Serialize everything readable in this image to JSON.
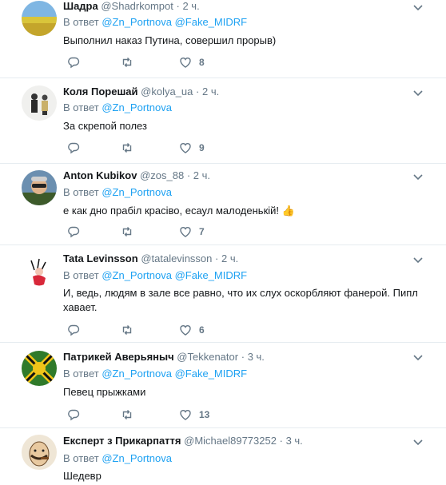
{
  "reply_prefix": "В ответ",
  "tweets": [
    {
      "name": "Шадра",
      "handle": "@Shadrkompot",
      "time": "2 ч.",
      "mentions": [
        "@Zn_Portnova",
        "@Fake_MIDRF"
      ],
      "text": "Выполнил наказ Путина,  совершил прорыв)",
      "likes": "8"
    },
    {
      "name": "Коля Порешай",
      "handle": "@kolya_ua",
      "time": "2 ч.",
      "mentions": [
        "@Zn_Portnova"
      ],
      "text": "За скрепой полез",
      "likes": "9"
    },
    {
      "name": "Anton Kubikov",
      "handle": "@zos_88",
      "time": "2 ч.",
      "mentions": [
        "@Zn_Portnova"
      ],
      "text": "е как дно прабіл красіво, есаул малоденькій!",
      "emoji": "👍",
      "likes": "7"
    },
    {
      "name": "Tata Levinsson",
      "handle": "@tatalevinsson",
      "time": "2 ч.",
      "mentions": [
        "@Zn_Portnova",
        "@Fake_MIDRF"
      ],
      "text": "И, ведь, людям в зале все равно, что их слух оскорбляют фанерой. Пипл хавает.",
      "likes": "6"
    },
    {
      "name": "Патрикей Аверьяныч",
      "handle": "@Tekkenator",
      "time": "3 ч.",
      "mentions": [
        "@Zn_Portnova",
        "@Fake_MIDRF"
      ],
      "text": "Певец прыжками",
      "likes": "13"
    },
    {
      "name": "Експерт з Прикарпаття",
      "handle": "@Michael89773252",
      "time": "3 ч.",
      "mentions": [
        "@Zn_Portnova"
      ],
      "text": "Шедевр",
      "likes": ""
    }
  ],
  "icons": {
    "reply": "reply-icon",
    "retweet": "retweet-icon",
    "like": "heart-icon",
    "more": "chevron-down-icon"
  },
  "colors": {
    "accent": "#1da1f2",
    "secondary": "#657786",
    "divider": "#e6ecf0"
  }
}
